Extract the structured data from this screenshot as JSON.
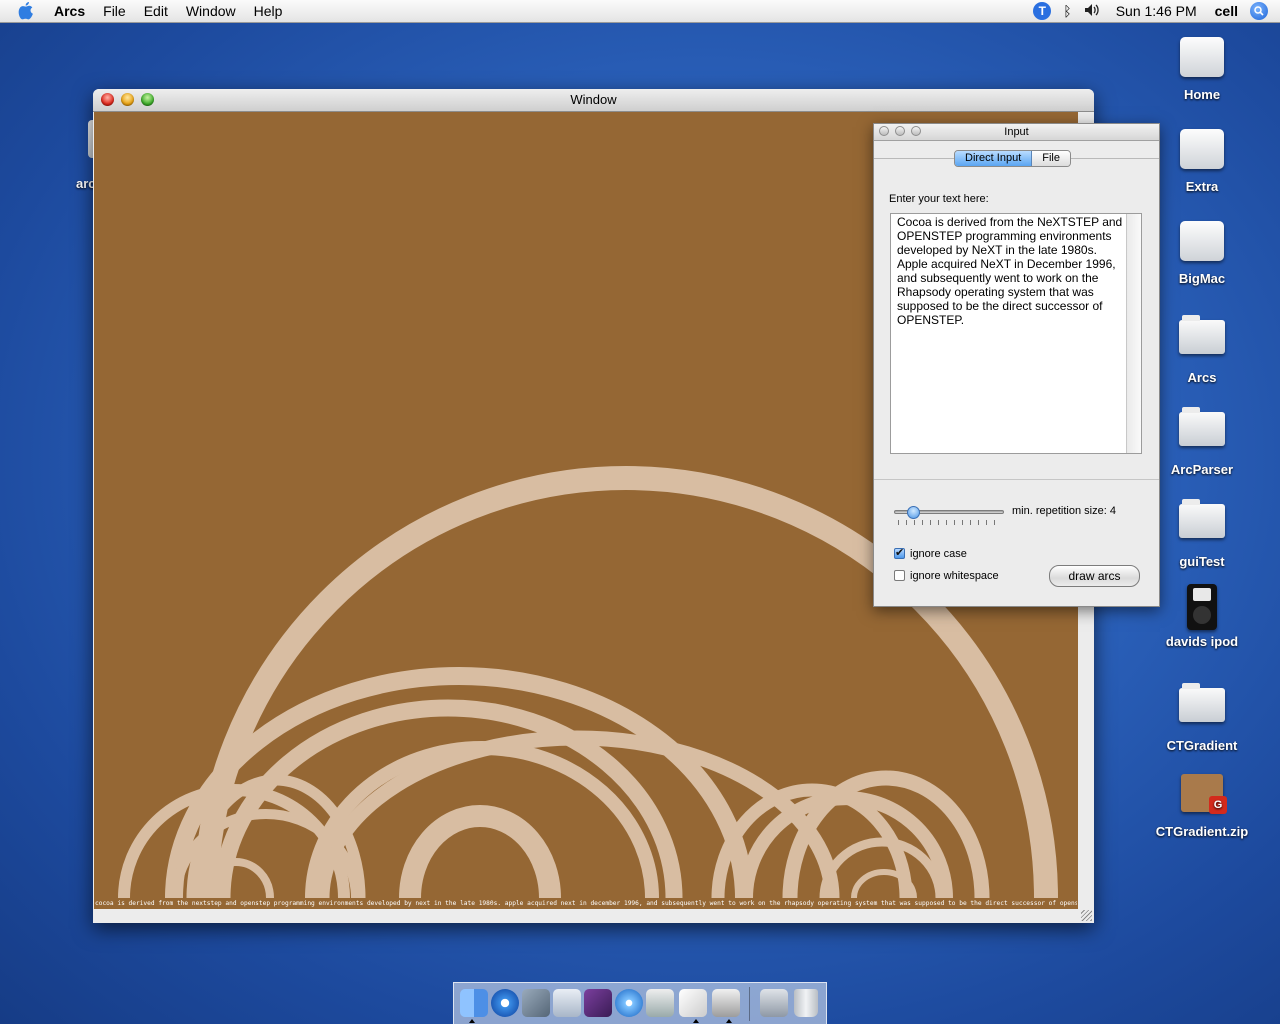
{
  "menubar": {
    "app_name": "Arcs",
    "menus": [
      "File",
      "Edit",
      "Window",
      "Help"
    ],
    "clock": "Sun 1:46 PM",
    "user": "cell"
  },
  "desktop": {
    "icons": [
      {
        "label": "Home",
        "icon": "drive-icon"
      },
      {
        "label": "Extra",
        "icon": "drive-icon"
      },
      {
        "label": "BigMac",
        "icon": "drive-icon"
      },
      {
        "label": "Arcs",
        "icon": "folder-icon"
      },
      {
        "label": "ArcParser",
        "icon": "folder-icon"
      },
      {
        "label": "guiTest",
        "icon": "folder-icon"
      },
      {
        "label": "davids ipod",
        "icon": "ipod-icon"
      },
      {
        "label": "CTGradient",
        "icon": "folder-icon"
      },
      {
        "label": "CTGradient.zip",
        "icon": "zip-icon"
      }
    ],
    "partial_icon_label": "arc"
  },
  "main_window": {
    "title": "Window",
    "canvas_color": "#956734",
    "arc_color": "#f2dfcd",
    "caption": "cocoa is derived from the nextstep and openstep programming environments developed by next in the late 1980s. apple acquired next in december 1996, and subsequently went to work on the rhapsody operating system that was supposed to be the direct successor of openstep."
  },
  "input_panel": {
    "title": "Input",
    "tabs": [
      "Direct Input",
      "File"
    ],
    "active_tab": "Direct Input",
    "prompt": "Enter your text here:",
    "text": "Cocoa is derived from the NeXTSTEP and OPENSTEP programming environments developed by NeXT in the late 1980s. Apple acquired NeXT in December 1996, and subsequently went to work on the Rhapsody operating system that was supposed to be the direct successor of OPENSTEP.",
    "slider_label": "min. repetition size: 4",
    "slider_value": 4,
    "checkboxes": [
      {
        "label": "ignore case",
        "checked": true
      },
      {
        "label": "ignore whitespace",
        "checked": false
      }
    ],
    "button": "draw arcs"
  },
  "dock": {
    "items": [
      "finder-icon",
      "safari-icon",
      "xcode-icon",
      "font-book-icon",
      "app-icon",
      "itunes-icon",
      "system-prefs-icon",
      "textedit-icon",
      "terminal-icon",
      "documents-icon",
      "trash-icon"
    ]
  }
}
